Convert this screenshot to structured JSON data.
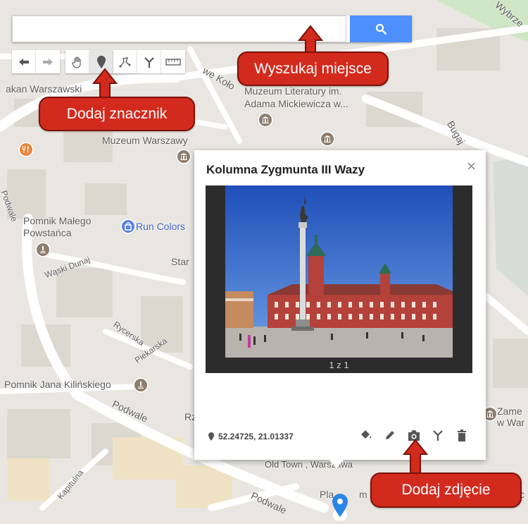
{
  "search": {
    "placeholder": "",
    "value": ""
  },
  "toolbar": {
    "items": [
      "undo",
      "redo",
      "pan",
      "marker",
      "draw-line",
      "route",
      "measure"
    ]
  },
  "callouts": {
    "search": "Wyszukaj miejsce",
    "marker": "Dodaj znacznik",
    "photo": "Dodaj zdjęcie"
  },
  "map_labels": {
    "akan": "akan Warszawski",
    "kolo": "we Koło",
    "muzeum_lit": "Muzeum Literatury im.",
    "muzeum_lit2": "Adama Mickiewicza w...",
    "muzeum_w": "Muzeum Warszawy",
    "bugaj": "Bugaj",
    "wybrz": "Wybrze",
    "podwale1": "Podwale",
    "pomnik_m": "Pomnik Małego",
    "powstanca": "Powstańca",
    "run": "Run Colors",
    "wask": "Wąski Dunaj",
    "star": "Star",
    "rycerska": "Rycerska",
    "piekarska": "Piekarska",
    "kilinski": "Pomnik Jana Kilińskiego",
    "podwale2": "Podwale",
    "rz": "Rz",
    "zame": "Zame",
    "wwar": "w War",
    "oldtown": "Old Town , Warszawa",
    "kapitulna": "Kapitulna",
    "podwale3": "Podwale",
    "pla": "Pla",
    "m": "m",
    "c": "c"
  },
  "popup": {
    "title": "Kolumna Zygmunta III Wazy",
    "photo_caption": "1 z 1",
    "coords": "52.24725, 21.01337",
    "close": "×"
  },
  "colors": {
    "accent": "#4d90fe",
    "callout": "#d32a1e",
    "marker": "#2a86e6"
  }
}
